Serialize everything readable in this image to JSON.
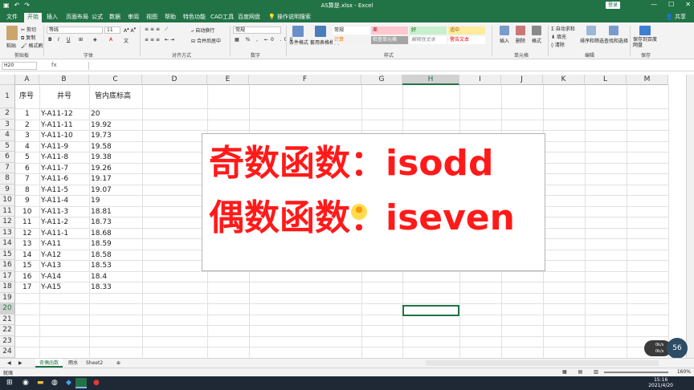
{
  "app": {
    "title": "AS算是.xlsx - Excel",
    "signin": "登录",
    "share": "共享",
    "quick_access": [
      "保存",
      "撤销",
      "重做"
    ],
    "window_buttons": [
      "—",
      "☐",
      "✕"
    ]
  },
  "ribbon_tabs": [
    "文件",
    "开始",
    "插入",
    "页面布局",
    "公式",
    "数据",
    "审阅",
    "视图",
    "帮助",
    "特色功能",
    "CAD工具",
    "百度网盘",
    "操作说明搜索"
  ],
  "active_tab": "开始",
  "ribbon": {
    "clipboard": {
      "label": "剪贴板",
      "paste": "粘贴",
      "cut": "剪切",
      "copy": "复制",
      "format_painter": "格式刷"
    },
    "font": {
      "label": "字体",
      "font_name": "等线",
      "font_size": "11"
    },
    "alignment": {
      "label": "对齐方式",
      "wrap": "自动换行",
      "merge": "合并后居中"
    },
    "number": {
      "label": "数字",
      "format": "常规"
    },
    "styles": {
      "label": "样式",
      "conditional": "条件格式",
      "table": "套用表格格式",
      "cells": [
        {
          "text": "常规",
          "bg": "#ffffff",
          "color": "#222222"
        },
        {
          "text": "差",
          "bg": "#ffc7ce",
          "color": "#9c0006"
        },
        {
          "text": "好",
          "bg": "#c6efce",
          "color": "#006100"
        },
        {
          "text": "适中",
          "bg": "#ffeb9c",
          "color": "#9c5700"
        },
        {
          "text": "计算",
          "bg": "#f2f2f2",
          "color": "#fa7d00"
        },
        {
          "text": "检查单元格",
          "bg": "#a5a5a5",
          "color": "#ffffff"
        },
        {
          "text": "解释性文本",
          "bg": "#ffffff",
          "color": "#7f7f7f"
        },
        {
          "text": "警告文本",
          "bg": "#ffffff",
          "color": "#ff0000"
        }
      ]
    },
    "cells_group": {
      "label": "单元格",
      "insert": "插入",
      "delete": "删除",
      "format": "格式"
    },
    "editing": {
      "label": "编辑",
      "autosum": "自动求和",
      "fill": "填充",
      "clear": "清除",
      "sort": "排序和筛选",
      "find": "查找和选择"
    },
    "save": {
      "label": "保存",
      "save_to_baidu": "保存到百度网盘"
    }
  },
  "formula_bar": {
    "name_box": "H20",
    "fx": "fx",
    "content": ""
  },
  "columns": [
    "A",
    "B",
    "C",
    "D",
    "E",
    "F",
    "G",
    "H",
    "I",
    "J",
    "K",
    "L",
    "M"
  ],
  "selected_column": "H",
  "selected_row": "20",
  "rows": [
    "1",
    "2",
    "3",
    "4",
    "5",
    "6",
    "7",
    "8",
    "9",
    "10",
    "11",
    "12",
    "13",
    "14",
    "15",
    "16",
    "17",
    "18",
    "19",
    "20",
    "21",
    "22",
    "23",
    "24"
  ],
  "table": {
    "headers": [
      "序号",
      "井号",
      "管内底标高"
    ],
    "data": [
      [
        "1",
        "Y-A11-12",
        "20"
      ],
      [
        "2",
        "Y-A11-11",
        "19.92"
      ],
      [
        "3",
        "Y-A11-10",
        "19.73"
      ],
      [
        "4",
        "Y-A11-9",
        "19.58"
      ],
      [
        "5",
        "Y-A11-8",
        "19.38"
      ],
      [
        "6",
        "Y-A11-7",
        "19.26"
      ],
      [
        "7",
        "Y-A11-6",
        "19.17"
      ],
      [
        "8",
        "Y-A11-5",
        "19.07"
      ],
      [
        "9",
        "Y-A11-4",
        "19"
      ],
      [
        "10",
        "Y-A11-3",
        "18.81"
      ],
      [
        "11",
        "Y-A11-2",
        "18.73"
      ],
      [
        "12",
        "Y-A11-1",
        "18.68"
      ],
      [
        "13",
        "Y-A11",
        "18.59"
      ],
      [
        "14",
        "Y-A12",
        "18.58"
      ],
      [
        "15",
        "Y-A13",
        "18.53"
      ],
      [
        "16",
        "Y-A14",
        "18.4"
      ],
      [
        "17",
        "Y-A15",
        "18.33"
      ]
    ]
  },
  "overlay": {
    "line1": "奇数函数：isodd",
    "line2": "偶数函数：iseven"
  },
  "sheets": [
    "奇偶函数",
    "雨水",
    "Sheet2"
  ],
  "active_sheet": "奇偶函数",
  "add_sheet": "⊕",
  "status": {
    "ready": "就绪",
    "zoom": "160%"
  },
  "badge": "56",
  "speed": {
    "up": "0k/s",
    "down": "0k/s"
  },
  "taskbar": {
    "time": "15:16",
    "date": "2021/4/20"
  }
}
